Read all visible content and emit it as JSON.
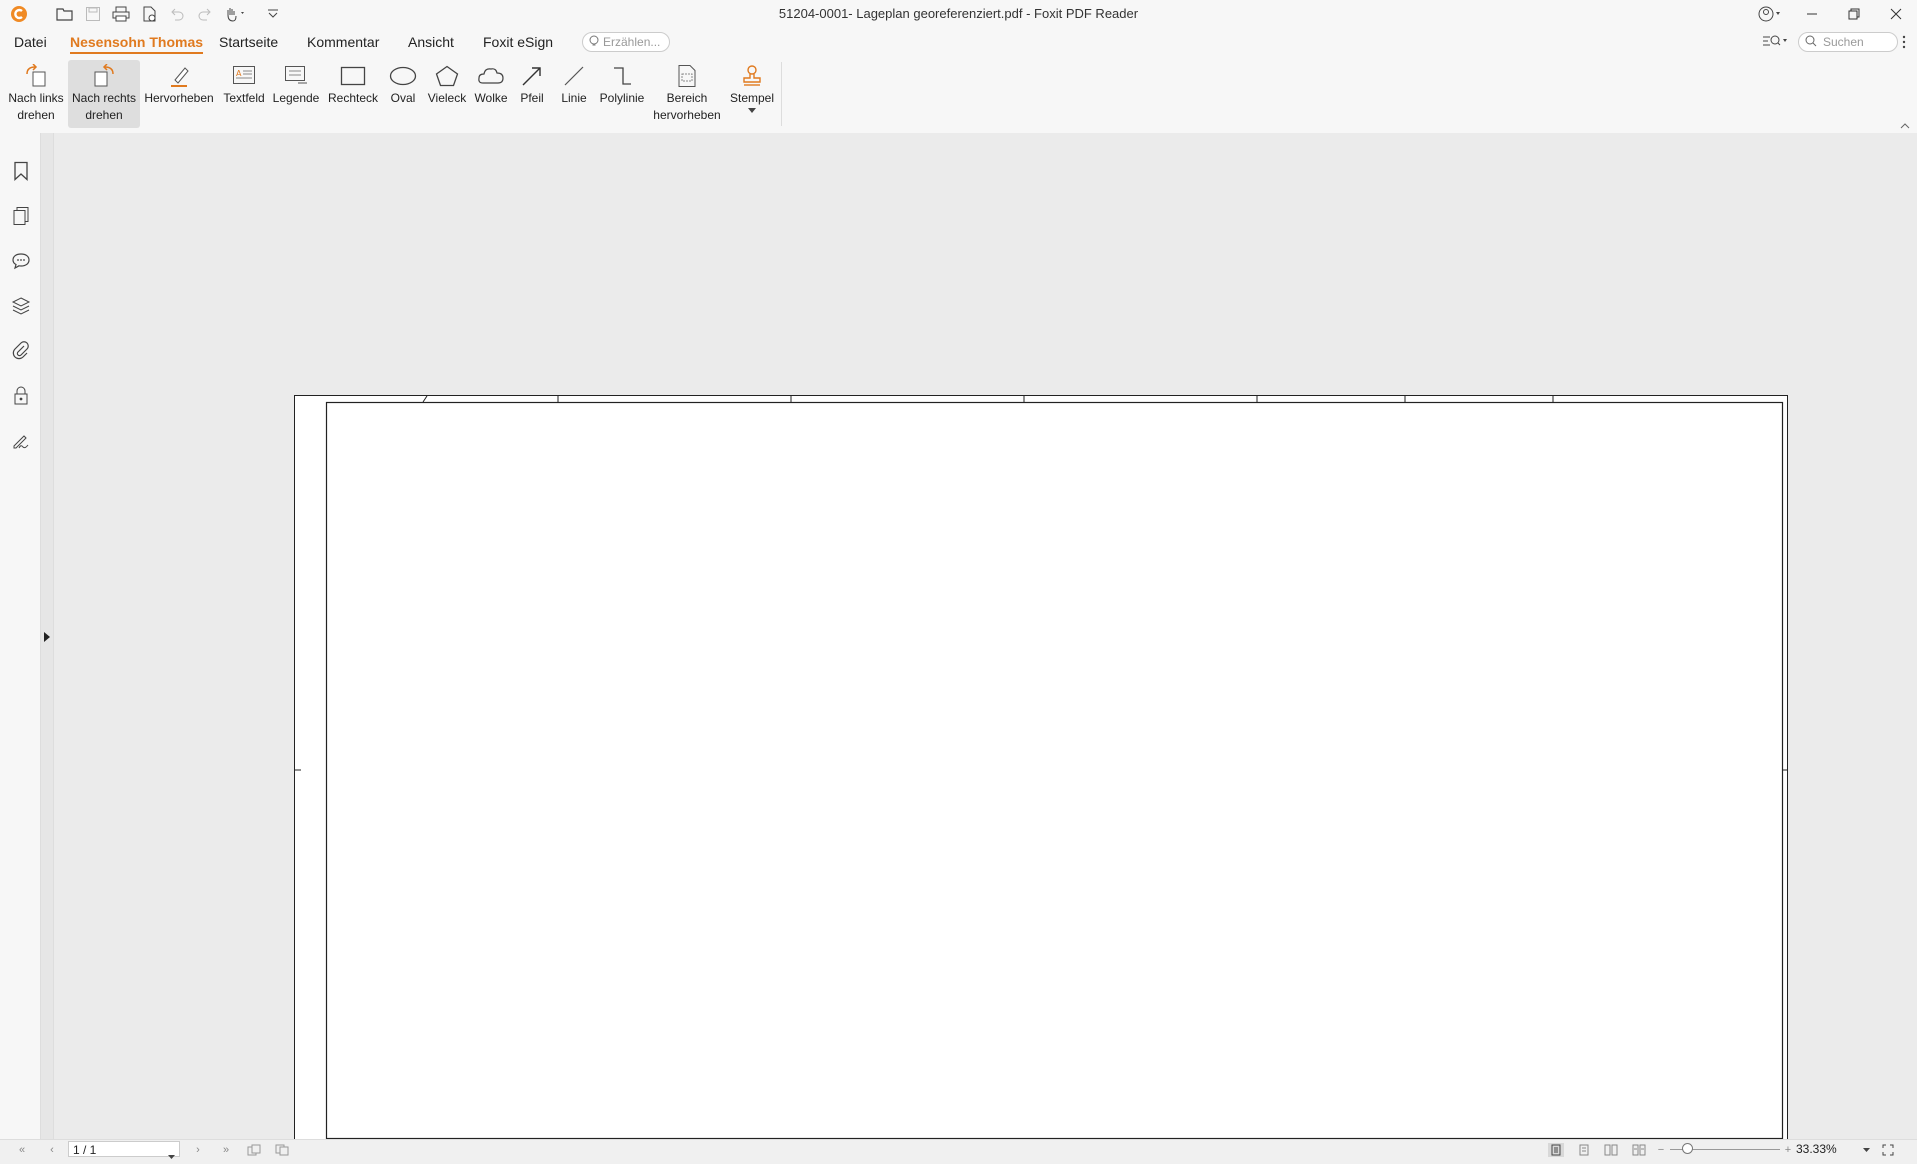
{
  "window": {
    "title": "51204-0001- Lageplan georeferenziert.pdf - Foxit PDF Reader"
  },
  "quick_access": [
    "app-logo-icon",
    "open-icon",
    "save-icon",
    "print-icon",
    "new-doc-icon",
    "undo-icon",
    "redo-icon",
    "hand-tool-icon",
    "customize-icon"
  ],
  "menu": {
    "items": [
      {
        "label": "Datei",
        "active": false
      },
      {
        "label": "Nesensohn Thomas",
        "active": true
      },
      {
        "label": "Startseite",
        "active": false
      },
      {
        "label": "Kommentar",
        "active": false
      },
      {
        "label": "Ansicht",
        "active": false
      },
      {
        "label": "Foxit eSign",
        "active": false
      }
    ],
    "tell_me_placeholder": "Erzählen...",
    "search_placeholder": "Suchen"
  },
  "ribbon": {
    "tools": [
      {
        "line1": "Nach links",
        "line2": "drehen",
        "icon": "rotate-left-icon"
      },
      {
        "line1": "Nach rechts",
        "line2": "drehen",
        "icon": "rotate-right-icon",
        "selected": true
      },
      {
        "line1": "Hervorheben",
        "line2": "",
        "icon": "highlight-icon"
      },
      {
        "line1": "Textfeld",
        "line2": "",
        "icon": "textbox-icon"
      },
      {
        "line1": "Legende",
        "line2": "",
        "icon": "callout-icon"
      },
      {
        "line1": "Rechteck",
        "line2": "",
        "icon": "rectangle-icon"
      },
      {
        "line1": "Oval",
        "line2": "",
        "icon": "oval-icon"
      },
      {
        "line1": "Vieleck",
        "line2": "",
        "icon": "polygon-icon"
      },
      {
        "line1": "Wolke",
        "line2": "",
        "icon": "cloud-icon"
      },
      {
        "line1": "Pfeil",
        "line2": "",
        "icon": "arrow-icon"
      },
      {
        "line1": "Linie",
        "line2": "",
        "icon": "line-icon"
      },
      {
        "line1": "Polylinie",
        "line2": "",
        "icon": "polyline-icon"
      },
      {
        "line1": "Bereich",
        "line2": "hervorheben",
        "icon": "area-highlight-icon"
      },
      {
        "line1": "Stempel",
        "line2": "",
        "icon": "stamp-icon"
      }
    ]
  },
  "sidebar": [
    "bookmark-icon",
    "pages-icon",
    "comments-icon",
    "layers-icon",
    "attachments-icon",
    "security-icon",
    "signature-icon"
  ],
  "status": {
    "page": "1 / 1",
    "zoom": "33.33%"
  }
}
